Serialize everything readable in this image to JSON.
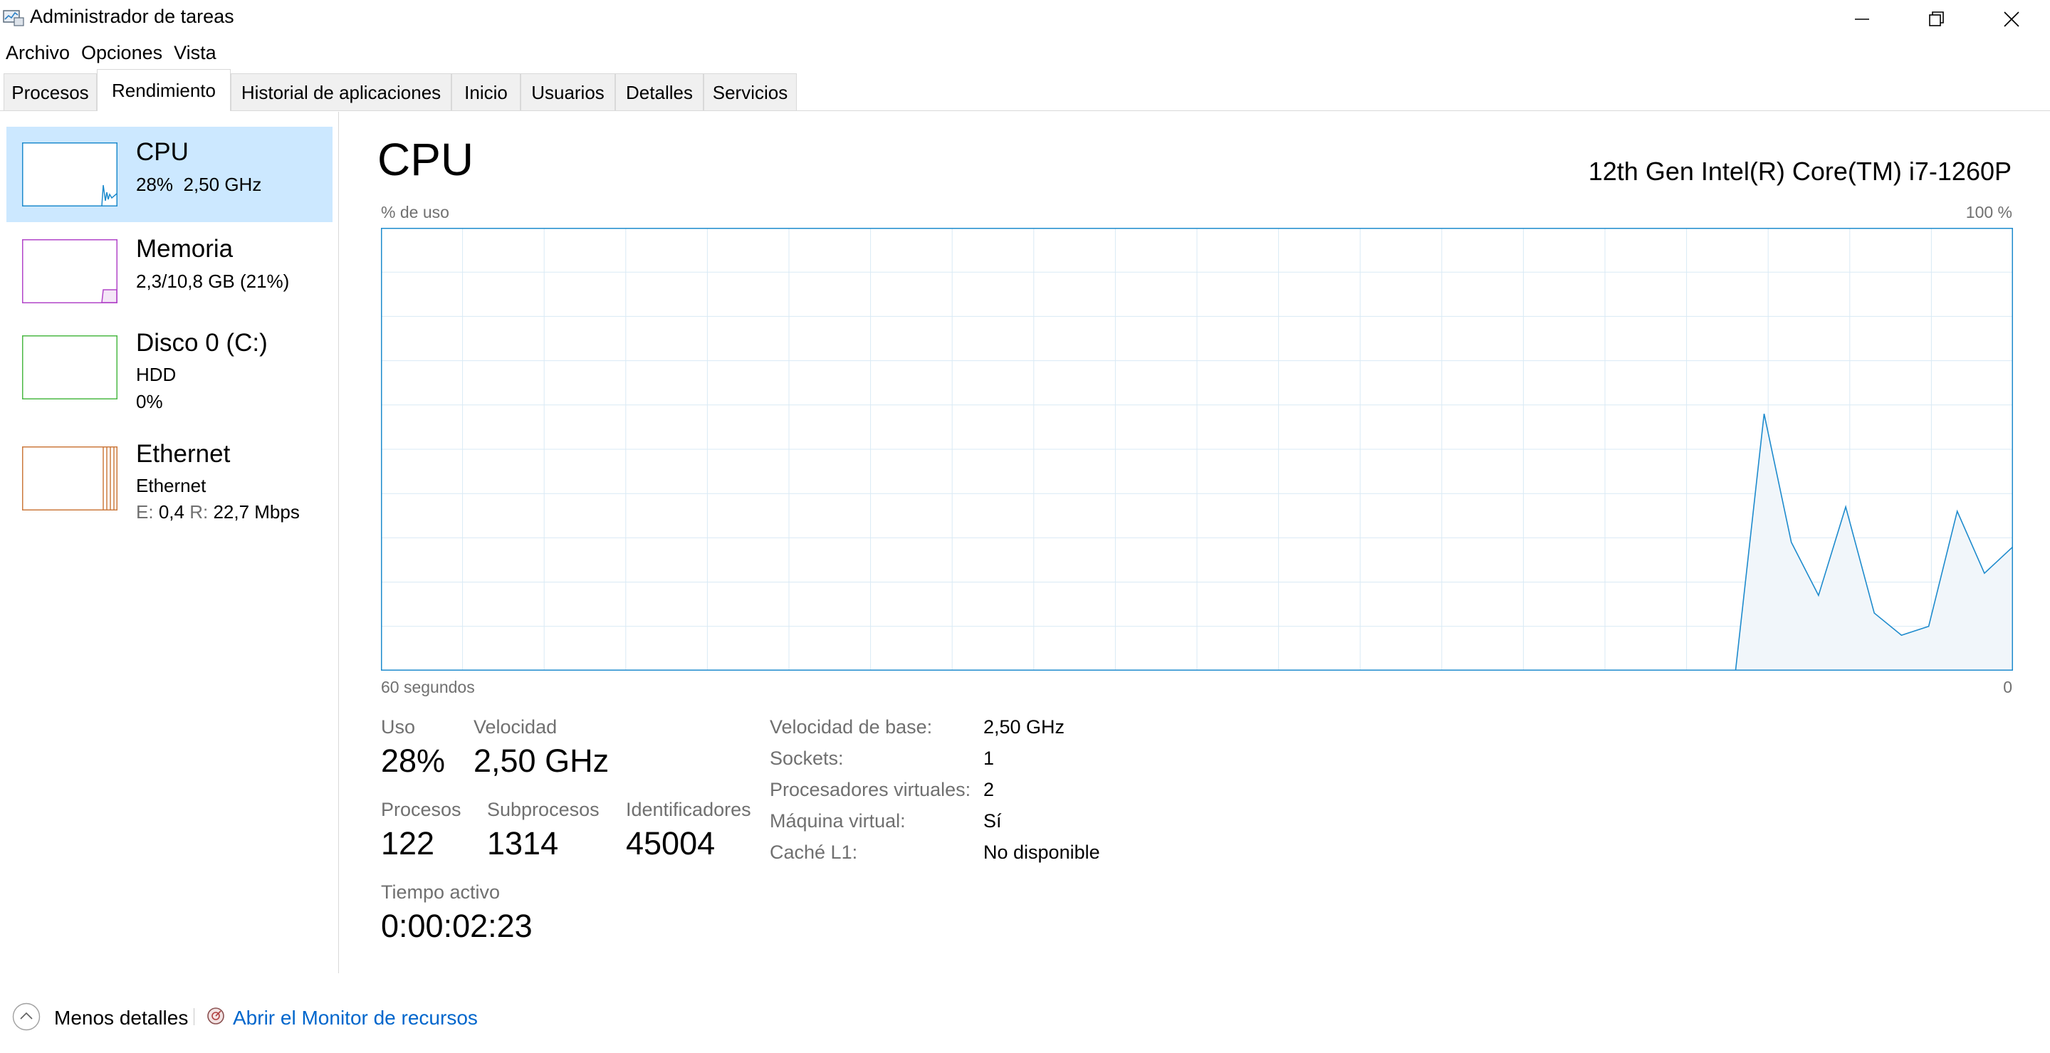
{
  "window": {
    "title": "Administrador de tareas",
    "controls": [
      "minimize-icon",
      "restore-icon",
      "close-icon"
    ]
  },
  "menu": [
    "Archivo",
    "Opciones",
    "Vista"
  ],
  "tabs": [
    {
      "label": "Procesos",
      "active": false
    },
    {
      "label": "Rendimiento",
      "active": true
    },
    {
      "label": "Historial de aplicaciones",
      "active": false
    },
    {
      "label": "Inicio",
      "active": false
    },
    {
      "label": "Usuarios",
      "active": false
    },
    {
      "label": "Detalles",
      "active": false
    },
    {
      "label": "Servicios",
      "active": false
    }
  ],
  "sidebar": {
    "cpu": {
      "title": "CPU",
      "usage": "28%",
      "speed": "2,50 GHz",
      "color": "#1e8bcd"
    },
    "memory": {
      "title": "Memoria",
      "detail": "2,3/10,8 GB (21%)",
      "color": "#b246c9"
    },
    "disk": {
      "title": "Disco 0 (C:)",
      "type": "HDD",
      "usage": "0%",
      "color": "#4cb946"
    },
    "ethernet": {
      "title": "Ethernet",
      "name": "Ethernet",
      "send_label": "E:",
      "send_value": "0,4",
      "recv_label": "R:",
      "recv_value": "22,7 Mbps",
      "color": "#cc7a3e"
    }
  },
  "main": {
    "title": "CPU",
    "model": "12th Gen Intel(R) Core(TM) i7-1260P",
    "graph_top_left": "% de uso",
    "graph_top_right": "100 %",
    "graph_bottom_left": "60 segundos",
    "graph_bottom_right": "0",
    "accent_color": "#1e8bcd"
  },
  "stats": {
    "uso_label": "Uso",
    "uso_value": "28%",
    "velocidad_label": "Velocidad",
    "velocidad_value": "2,50 GHz",
    "procesos_label": "Procesos",
    "procesos_value": "122",
    "subprocesos_label": "Subprocesos",
    "subprocesos_value": "1314",
    "identificadores_label": "Identificadores",
    "identificadores_value": "45004",
    "tiempo_label": "Tiempo activo",
    "tiempo_value": "0:00:02:23"
  },
  "info": [
    {
      "label": "Velocidad de base:",
      "value": "2,50 GHz"
    },
    {
      "label": "Sockets:",
      "value": "1"
    },
    {
      "label": "Procesadores virtuales:",
      "value": "2"
    },
    {
      "label": "Máquina virtual:",
      "value": "Sí"
    },
    {
      "label": "Caché L1:",
      "value": "No disponible"
    }
  ],
  "footer": {
    "less_details": "Menos detalles",
    "resource_monitor": "Abrir el Monitor de recursos"
  },
  "chart_data": {
    "type": "area",
    "ylabel": "% de uso",
    "ylim": [
      0,
      100
    ],
    "xlim": [
      60,
      0
    ],
    "grid": true,
    "x": [
      60,
      9,
      7,
      6,
      5,
      4,
      3,
      2,
      1,
      0
    ],
    "values": [
      0,
      0,
      58,
      28,
      16,
      37,
      13,
      8,
      10,
      36,
      22,
      28
    ]
  },
  "chart_points": [
    {
      "t": 60,
      "v": 0
    },
    {
      "t": 10.2,
      "v": 0
    },
    {
      "t": 9.15,
      "v": 58
    },
    {
      "t": 8.15,
      "v": 29
    },
    {
      "t": 7.15,
      "v": 17
    },
    {
      "t": 6.15,
      "v": 37
    },
    {
      "t": 5.1,
      "v": 13
    },
    {
      "t": 4.1,
      "v": 8
    },
    {
      "t": 3.1,
      "v": 10
    },
    {
      "t": 2.05,
      "v": 36
    },
    {
      "t": 1.05,
      "v": 22
    },
    {
      "t": 0,
      "v": 28
    }
  ]
}
